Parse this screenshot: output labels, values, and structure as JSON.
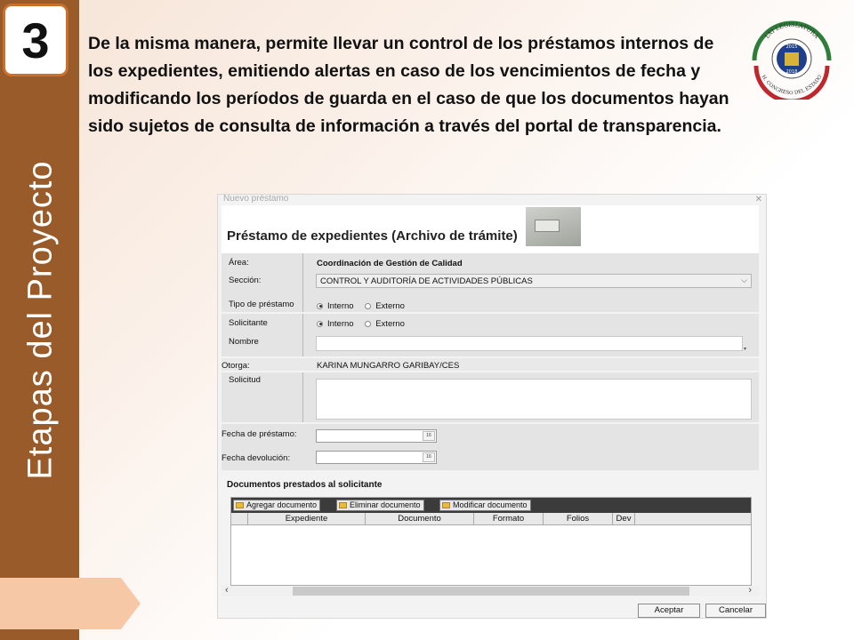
{
  "slide": {
    "step_number": "3",
    "vertical_title": "Etapas  del Proyecto",
    "intro_text": "De la misma manera, permite llevar un control de los préstamos internos de los expedientes, emitiendo alertas en caso de los vencimientos de fecha y modificando los períodos de guarda en el caso de que los documentos hayan sido sujetos de consulta de información a través del portal de transparencia.",
    "logo": {
      "top_text": "LXI LEGISLATURA",
      "year_start": "2015",
      "year_end": "2018",
      "bottom_text": "H. CONGRESO DEL ESTADO"
    }
  },
  "dialog": {
    "window_title": "Nuevo préstamo",
    "heading": "Préstamo de expedientes (Archivo de trámite)",
    "area_label": "Área:",
    "area_value": "Coordinación de Gestión de Calidad",
    "seccion_label": "Sección:",
    "seccion_value": "CONTROL Y AUDITORÍA DE ACTIVIDADES PÚBLICAS",
    "tipo_label": "Tipo de préstamo",
    "tipo_options": [
      "Interno",
      "Externo"
    ],
    "solicitante_label": "Solicitante",
    "solicitante_options": [
      "Interno",
      "Externo"
    ],
    "nombre_label": "Nombre",
    "otorga_label": "Otorga:",
    "otorga_value": "KARINA MUNGARRO GARIBAY/CES",
    "solicitud_label": "Solicitud",
    "fecha_prestamo_label": "Fecha de préstamo:",
    "fecha_devolucion_label": "Fecha devolución:",
    "calendar_glyph": "16",
    "docs_section_title": "Documentos prestados al solicitante",
    "toolbar": {
      "add": "Agregar documento",
      "delete": "Eliminar documento",
      "modify": "Modificar documento"
    },
    "columns": [
      "Expediente",
      "Documento",
      "Formato",
      "Folios",
      "Dev"
    ],
    "accept_button": "Aceptar",
    "cancel_button": "Cancelar"
  },
  "colors": {
    "sidebar": "#9a5b2a",
    "step_border": "#c8702c",
    "arrow_tab": "#f7c8a6",
    "toolbar_dark": "#3b3b3b"
  }
}
